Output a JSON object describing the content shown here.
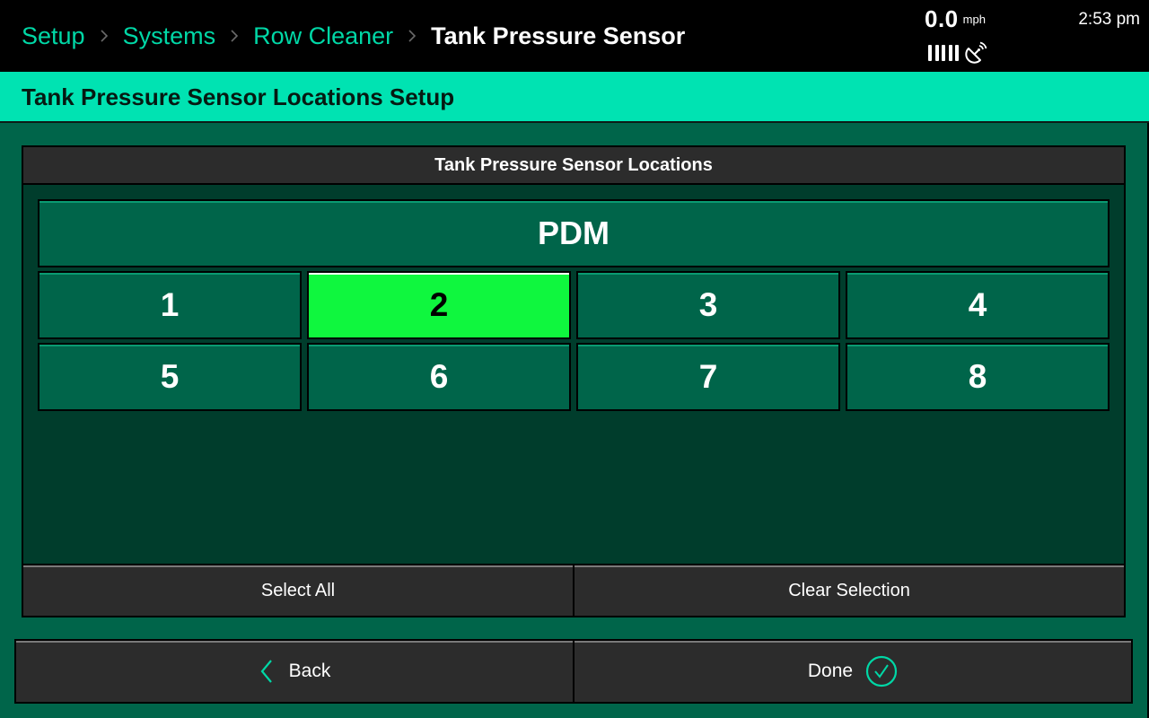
{
  "topbar": {
    "breadcrumb": [
      {
        "label": "Setup"
      },
      {
        "label": "Systems"
      },
      {
        "label": "Row Cleaner"
      },
      {
        "label": "Tank Pressure Sensor"
      }
    ],
    "speed": {
      "value": "0.0",
      "unit": "mph"
    },
    "signal_bars": 5,
    "signal_icon": "satellite-dish-icon",
    "clock": "2:53 pm"
  },
  "page": {
    "title": "Tank Pressure Sensor Locations Setup"
  },
  "panel": {
    "header": "Tank Pressure Sensor Locations",
    "group_label": "PDM",
    "locations": [
      {
        "label": "1",
        "selected": false
      },
      {
        "label": "2",
        "selected": true
      },
      {
        "label": "3",
        "selected": false
      },
      {
        "label": "4",
        "selected": false
      },
      {
        "label": "5",
        "selected": false
      },
      {
        "label": "6",
        "selected": false
      },
      {
        "label": "7",
        "selected": false
      },
      {
        "label": "8",
        "selected": false
      }
    ],
    "select_all_label": "Select All",
    "clear_selection_label": "Clear Selection"
  },
  "nav": {
    "back_label": "Back",
    "done_label": "Done"
  },
  "colors": {
    "accent": "#00d7a6",
    "title_band": "#00e3b2",
    "background": "#00654a",
    "selected": "#0ff73e",
    "button_dark": "#2c2c2c"
  }
}
